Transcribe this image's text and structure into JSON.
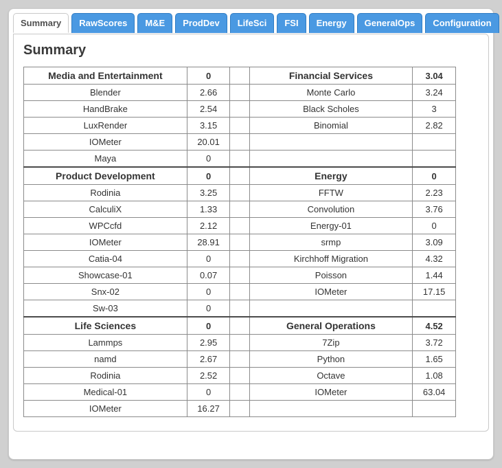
{
  "tabs": [
    {
      "id": "summary",
      "label": "Summary",
      "active": true
    },
    {
      "id": "rawscores",
      "label": "RawScores",
      "active": false
    },
    {
      "id": "me",
      "label": "M&E",
      "active": false
    },
    {
      "id": "proddev",
      "label": "ProdDev",
      "active": false
    },
    {
      "id": "lifesci",
      "label": "LifeSci",
      "active": false
    },
    {
      "id": "fsi",
      "label": "FSI",
      "active": false
    },
    {
      "id": "energy",
      "label": "Energy",
      "active": false
    },
    {
      "id": "generalops",
      "label": "GeneralOps",
      "active": false
    },
    {
      "id": "config",
      "label": "Configuration",
      "active": false
    }
  ],
  "heading": "Summary",
  "left_sections": [
    {
      "title": "Media and Entertainment",
      "score": "0",
      "rows": [
        {
          "name": "Blender",
          "value": "2.66"
        },
        {
          "name": "HandBrake",
          "value": "2.54"
        },
        {
          "name": "LuxRender",
          "value": "3.15"
        },
        {
          "name": "IOMeter",
          "value": "20.01"
        },
        {
          "name": "Maya",
          "value": "0"
        }
      ]
    },
    {
      "title": "Product Development",
      "score": "0",
      "rows": [
        {
          "name": "Rodinia",
          "value": "3.25"
        },
        {
          "name": "CalculiX",
          "value": "1.33"
        },
        {
          "name": "WPCcfd",
          "value": "2.12"
        },
        {
          "name": "IOMeter",
          "value": "28.91"
        },
        {
          "name": "Catia-04",
          "value": "0"
        },
        {
          "name": "Showcase-01",
          "value": "0.07"
        },
        {
          "name": "Snx-02",
          "value": "0"
        },
        {
          "name": "Sw-03",
          "value": "0"
        }
      ]
    },
    {
      "title": "Life Sciences",
      "score": "0",
      "rows": [
        {
          "name": "Lammps",
          "value": "2.95"
        },
        {
          "name": "namd",
          "value": "2.67"
        },
        {
          "name": "Rodinia",
          "value": "2.52"
        },
        {
          "name": "Medical-01",
          "value": "0"
        },
        {
          "name": "IOMeter",
          "value": "16.27"
        }
      ]
    }
  ],
  "right_sections": [
    {
      "title": "Financial Services",
      "score": "3.04",
      "rows": [
        {
          "name": "Monte Carlo",
          "value": "3.24"
        },
        {
          "name": "Black Scholes",
          "value": "3"
        },
        {
          "name": "Binomial",
          "value": "2.82"
        },
        {
          "name": "",
          "value": ""
        },
        {
          "name": "",
          "value": ""
        }
      ]
    },
    {
      "title": "Energy",
      "score": "0",
      "rows": [
        {
          "name": "FFTW",
          "value": "2.23"
        },
        {
          "name": "Convolution",
          "value": "3.76"
        },
        {
          "name": "Energy-01",
          "value": "0"
        },
        {
          "name": "srmp",
          "value": "3.09"
        },
        {
          "name": "Kirchhoff Migration",
          "value": "4.32"
        },
        {
          "name": "Poisson",
          "value": "1.44"
        },
        {
          "name": "IOMeter",
          "value": "17.15"
        },
        {
          "name": "",
          "value": ""
        }
      ]
    },
    {
      "title": "General Operations",
      "score": "4.52",
      "rows": [
        {
          "name": "7Zip",
          "value": "3.72"
        },
        {
          "name": "Python",
          "value": "1.65"
        },
        {
          "name": "Octave",
          "value": "1.08"
        },
        {
          "name": "IOMeter",
          "value": "63.04"
        },
        {
          "name": "",
          "value": ""
        }
      ]
    }
  ]
}
